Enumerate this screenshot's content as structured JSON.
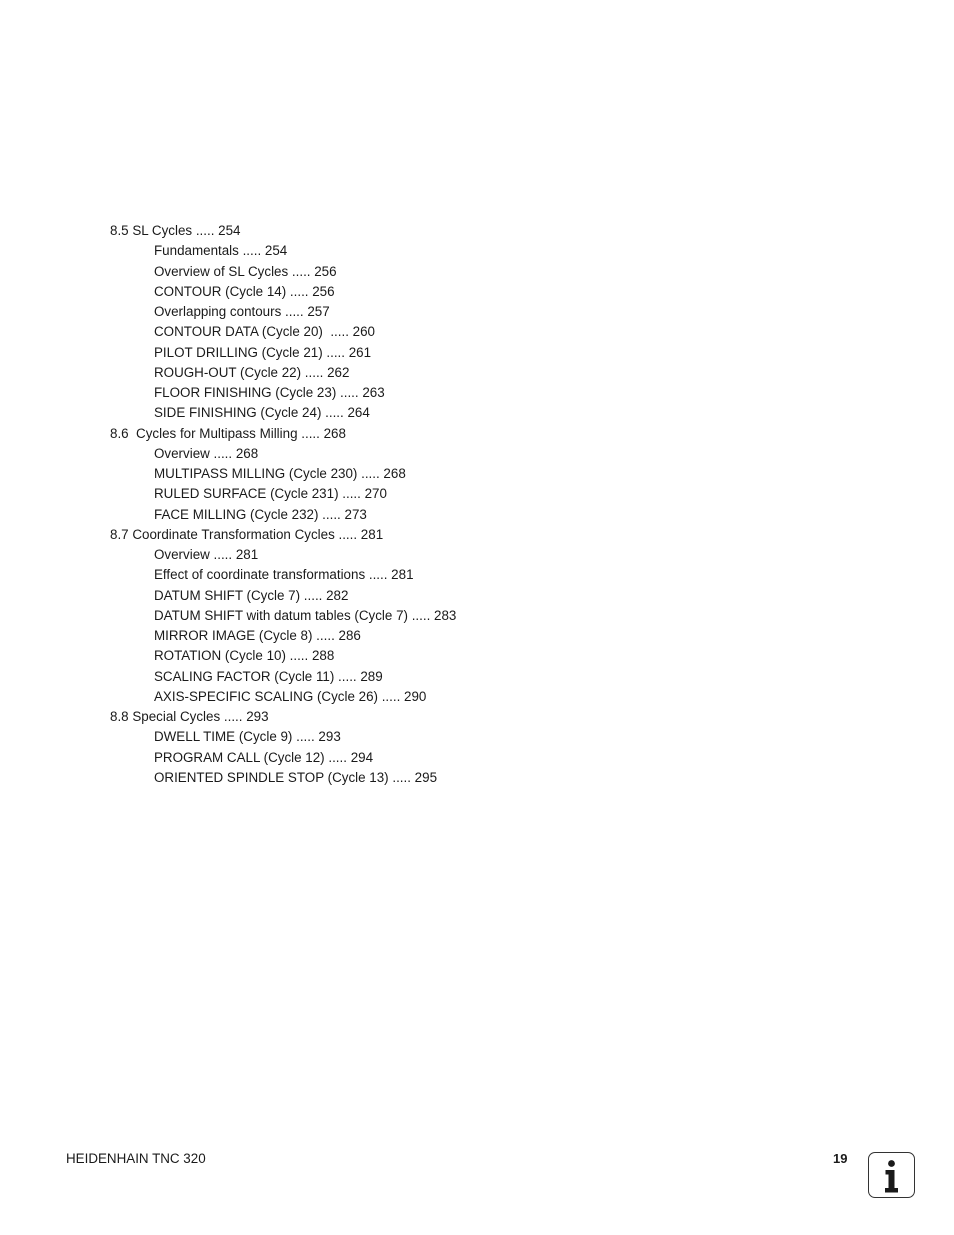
{
  "toc": {
    "entries": [
      {
        "level": 1,
        "text": "8.5 SL Cycles ..... 254"
      },
      {
        "level": 2,
        "text": "Fundamentals ..... 254"
      },
      {
        "level": 2,
        "text": "Overview of SL Cycles ..... 256"
      },
      {
        "level": 2,
        "text": "CONTOUR (Cycle 14) ..... 256"
      },
      {
        "level": 2,
        "text": "Overlapping contours ..... 257"
      },
      {
        "level": 2,
        "text": "CONTOUR DATA (Cycle 20)  ..... 260"
      },
      {
        "level": 2,
        "text": "PILOT DRILLING (Cycle 21) ..... 261"
      },
      {
        "level": 2,
        "text": "ROUGH-OUT (Cycle 22) ..... 262"
      },
      {
        "level": 2,
        "text": "FLOOR FINISHING (Cycle 23) ..... 263"
      },
      {
        "level": 2,
        "text": "SIDE FINISHING (Cycle 24) ..... 264"
      },
      {
        "level": 1,
        "text": "8.6  Cycles for Multipass Milling ..... 268"
      },
      {
        "level": 2,
        "text": "Overview ..... 268"
      },
      {
        "level": 2,
        "text": "MULTIPASS MILLING (Cycle 230) ..... 268"
      },
      {
        "level": 2,
        "text": "RULED SURFACE (Cycle 231) ..... 270"
      },
      {
        "level": 2,
        "text": "FACE MILLING (Cycle 232) ..... 273"
      },
      {
        "level": 1,
        "text": "8.7 Coordinate Transformation Cycles ..... 281"
      },
      {
        "level": 2,
        "text": "Overview ..... 281"
      },
      {
        "level": 2,
        "text": "Effect of coordinate transformations ..... 281"
      },
      {
        "level": 2,
        "text": "DATUM SHIFT (Cycle 7) ..... 282"
      },
      {
        "level": 2,
        "text": "DATUM SHIFT with datum tables (Cycle 7) ..... 283"
      },
      {
        "level": 2,
        "text": "MIRROR IMAGE (Cycle 8) ..... 286"
      },
      {
        "level": 2,
        "text": "ROTATION (Cycle 10) ..... 288"
      },
      {
        "level": 2,
        "text": "SCALING FACTOR (Cycle 11) ..... 289"
      },
      {
        "level": 2,
        "text": "AXIS-SPECIFIC SCALING (Cycle 26) ..... 290"
      },
      {
        "level": 1,
        "text": "8.8 Special Cycles ..... 293"
      },
      {
        "level": 2,
        "text": "DWELL TIME (Cycle 9) ..... 293"
      },
      {
        "level": 2,
        "text": "PROGRAM CALL (Cycle 12) ..... 294"
      },
      {
        "level": 2,
        "text": "ORIENTED SPINDLE STOP (Cycle 13) ..... 295"
      }
    ]
  },
  "footer": {
    "title": "HEIDENHAIN TNC 320",
    "page_number": "19",
    "icon": "info-icon"
  }
}
